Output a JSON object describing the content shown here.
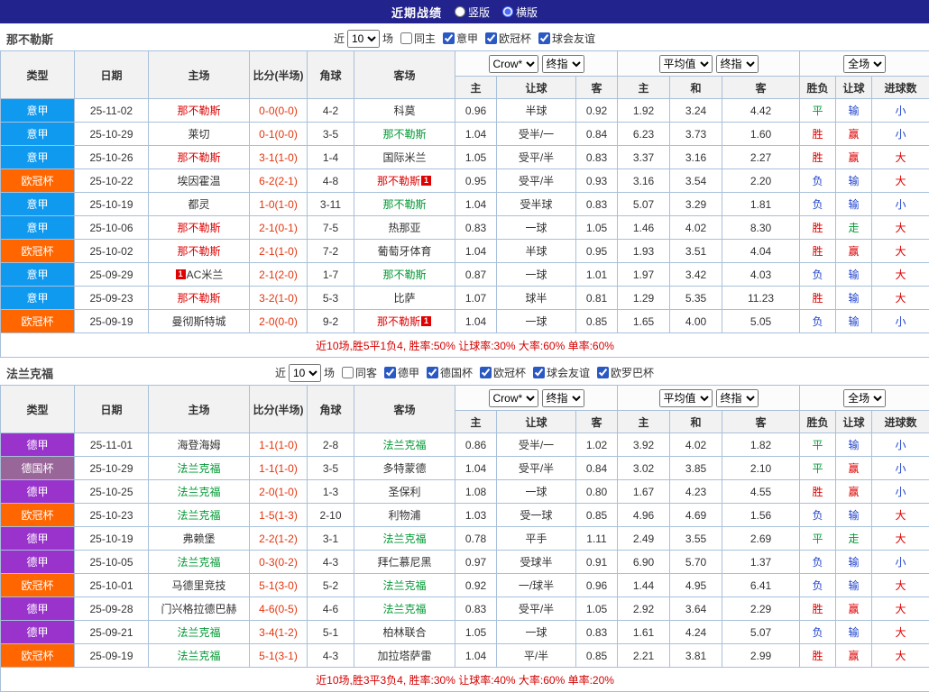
{
  "topbar": {
    "title": "近期战绩",
    "radio_vertical": "竖版",
    "radio_horizontal": "横版",
    "selected_layout": "横版"
  },
  "colors": {
    "topbar_bg": "#23238e",
    "border": "#a8c0da",
    "score": "#e3350d",
    "type": {
      "意甲": "#0f9af0",
      "欧冠杯": "#ff6600",
      "德甲": "#9933cc",
      "德国杯": "#996699"
    },
    "text": {
      "red": "#dd0000",
      "green": "#009933",
      "blue": "#2244cc",
      "black": "#333333"
    }
  },
  "filter_labels": {
    "near": "近",
    "games": "场"
  },
  "table": {
    "col_headers": [
      "类型",
      "日期",
      "主场",
      "比分(半场)",
      "角球",
      "客场"
    ],
    "sub_headers": [
      "主",
      "让球",
      "客",
      "主",
      "和",
      "客",
      "胜负",
      "让球",
      "进球数"
    ],
    "selects": {
      "odds": "Crow*",
      "odds_stage": "终指",
      "euro": "平均值",
      "euro_stage": "终指",
      "scope": "全场"
    }
  },
  "sections": [
    {
      "team": "那不勒斯",
      "filters": {
        "count": "10",
        "checkboxes": [
          {
            "label": "同主",
            "checked": false
          },
          {
            "label": "意甲",
            "checked": true
          },
          {
            "label": "欧冠杯",
            "checked": true
          },
          {
            "label": "球会友谊",
            "checked": true
          }
        ]
      },
      "rows": [
        {
          "type": "意甲",
          "date": "25-11-02",
          "home": {
            "name": "那不勒斯",
            "color": "red"
          },
          "score": "0-0(0-0)",
          "corner": "4-2",
          "away": {
            "name": "科莫",
            "color": "black"
          },
          "odds": [
            "0.96",
            "半球",
            "0.92"
          ],
          "euro": [
            "1.92",
            "3.24",
            "4.42"
          ],
          "res": [
            {
              "t": "平",
              "c": "green"
            },
            {
              "t": "输",
              "c": "blue"
            },
            {
              "t": "小",
              "c": "blue"
            }
          ]
        },
        {
          "type": "意甲",
          "date": "25-10-29",
          "home": {
            "name": "莱切",
            "color": "black"
          },
          "score": "0-1(0-0)",
          "corner": "3-5",
          "away": {
            "name": "那不勒斯",
            "color": "green"
          },
          "odds": [
            "1.04",
            "受半/一",
            "0.84"
          ],
          "euro": [
            "6.23",
            "3.73",
            "1.60"
          ],
          "res": [
            {
              "t": "胜",
              "c": "red"
            },
            {
              "t": "赢",
              "c": "red"
            },
            {
              "t": "小",
              "c": "blue"
            }
          ]
        },
        {
          "type": "意甲",
          "date": "25-10-26",
          "home": {
            "name": "那不勒斯",
            "color": "red"
          },
          "score": "3-1(1-0)",
          "corner": "1-4",
          "away": {
            "name": "国际米兰",
            "color": "black"
          },
          "odds": [
            "1.05",
            "受平/半",
            "0.83"
          ],
          "euro": [
            "3.37",
            "3.16",
            "2.27"
          ],
          "res": [
            {
              "t": "胜",
              "c": "red"
            },
            {
              "t": "赢",
              "c": "red"
            },
            {
              "t": "大",
              "c": "red"
            }
          ]
        },
        {
          "type": "欧冠杯",
          "date": "25-10-22",
          "home": {
            "name": "埃因霍温",
            "color": "black"
          },
          "score": "6-2(2-1)",
          "corner": "4-8",
          "away": {
            "name": "那不勒斯",
            "color": "red",
            "badge": "1",
            "badge_pos": "after"
          },
          "odds": [
            "0.95",
            "受平/半",
            "0.93"
          ],
          "euro": [
            "3.16",
            "3.54",
            "2.20"
          ],
          "res": [
            {
              "t": "负",
              "c": "blue"
            },
            {
              "t": "输",
              "c": "blue"
            },
            {
              "t": "大",
              "c": "red"
            }
          ]
        },
        {
          "type": "意甲",
          "date": "25-10-19",
          "home": {
            "name": "都灵",
            "color": "black"
          },
          "score": "1-0(1-0)",
          "corner": "3-11",
          "away": {
            "name": "那不勒斯",
            "color": "green"
          },
          "odds": [
            "1.04",
            "受半球",
            "0.83"
          ],
          "euro": [
            "5.07",
            "3.29",
            "1.81"
          ],
          "res": [
            {
              "t": "负",
              "c": "blue"
            },
            {
              "t": "输",
              "c": "blue"
            },
            {
              "t": "小",
              "c": "blue"
            }
          ]
        },
        {
          "type": "意甲",
          "date": "25-10-06",
          "home": {
            "name": "那不勒斯",
            "color": "red"
          },
          "score": "2-1(0-1)",
          "corner": "7-5",
          "away": {
            "name": "热那亚",
            "color": "black"
          },
          "odds": [
            "0.83",
            "一球",
            "1.05"
          ],
          "euro": [
            "1.46",
            "4.02",
            "8.30"
          ],
          "res": [
            {
              "t": "胜",
              "c": "red"
            },
            {
              "t": "走",
              "c": "green"
            },
            {
              "t": "大",
              "c": "red"
            }
          ]
        },
        {
          "type": "欧冠杯",
          "date": "25-10-02",
          "home": {
            "name": "那不勒斯",
            "color": "red"
          },
          "score": "2-1(1-0)",
          "corner": "7-2",
          "away": {
            "name": "葡萄牙体育",
            "color": "black"
          },
          "odds": [
            "1.04",
            "半球",
            "0.95"
          ],
          "euro": [
            "1.93",
            "3.51",
            "4.04"
          ],
          "res": [
            {
              "t": "胜",
              "c": "red"
            },
            {
              "t": "赢",
              "c": "red"
            },
            {
              "t": "大",
              "c": "red"
            }
          ]
        },
        {
          "type": "意甲",
          "date": "25-09-29",
          "home": {
            "name": "AC米兰",
            "color": "black",
            "badge": "1",
            "badge_pos": "before"
          },
          "score": "2-1(2-0)",
          "corner": "1-7",
          "away": {
            "name": "那不勒斯",
            "color": "green"
          },
          "odds": [
            "0.87",
            "一球",
            "1.01"
          ],
          "euro": [
            "1.97",
            "3.42",
            "4.03"
          ],
          "res": [
            {
              "t": "负",
              "c": "blue"
            },
            {
              "t": "输",
              "c": "blue"
            },
            {
              "t": "大",
              "c": "red"
            }
          ]
        },
        {
          "type": "意甲",
          "date": "25-09-23",
          "home": {
            "name": "那不勒斯",
            "color": "red"
          },
          "score": "3-2(1-0)",
          "corner": "5-3",
          "away": {
            "name": "比萨",
            "color": "black"
          },
          "odds": [
            "1.07",
            "球半",
            "0.81"
          ],
          "euro": [
            "1.29",
            "5.35",
            "11.23"
          ],
          "res": [
            {
              "t": "胜",
              "c": "red"
            },
            {
              "t": "输",
              "c": "blue"
            },
            {
              "t": "大",
              "c": "red"
            }
          ]
        },
        {
          "type": "欧冠杯",
          "date": "25-09-19",
          "home": {
            "name": "曼彻斯特城",
            "color": "black"
          },
          "score": "2-0(0-0)",
          "corner": "9-2",
          "away": {
            "name": "那不勒斯",
            "color": "red",
            "badge": "1",
            "badge_pos": "after"
          },
          "odds": [
            "1.04",
            "一球",
            "0.85"
          ],
          "euro": [
            "1.65",
            "4.00",
            "5.05"
          ],
          "res": [
            {
              "t": "负",
              "c": "blue"
            },
            {
              "t": "输",
              "c": "blue"
            },
            {
              "t": "小",
              "c": "blue"
            }
          ]
        }
      ],
      "summary": "近10场,胜5平1负4, 胜率:50% 让球率:30% 大率:60% 单率:60%"
    },
    {
      "team": "法兰克福",
      "filters": {
        "count": "10",
        "checkboxes": [
          {
            "label": "同客",
            "checked": false
          },
          {
            "label": "德甲",
            "checked": true
          },
          {
            "label": "德国杯",
            "checked": true
          },
          {
            "label": "欧冠杯",
            "checked": true
          },
          {
            "label": "球会友谊",
            "checked": true
          },
          {
            "label": "欧罗巴杯",
            "checked": true
          }
        ]
      },
      "rows": [
        {
          "type": "德甲",
          "date": "25-11-01",
          "home": {
            "name": "海登海姆",
            "color": "black"
          },
          "score": "1-1(1-0)",
          "corner": "2-8",
          "away": {
            "name": "法兰克福",
            "color": "green"
          },
          "odds": [
            "0.86",
            "受半/一",
            "1.02"
          ],
          "euro": [
            "3.92",
            "4.02",
            "1.82"
          ],
          "res": [
            {
              "t": "平",
              "c": "green"
            },
            {
              "t": "输",
              "c": "blue"
            },
            {
              "t": "小",
              "c": "blue"
            }
          ]
        },
        {
          "type": "德国杯",
          "date": "25-10-29",
          "home": {
            "name": "法兰克福",
            "color": "green"
          },
          "score": "1-1(1-0)",
          "corner": "3-5",
          "away": {
            "name": "多特蒙德",
            "color": "black"
          },
          "odds": [
            "1.04",
            "受平/半",
            "0.84"
          ],
          "euro": [
            "3.02",
            "3.85",
            "2.10"
          ],
          "res": [
            {
              "t": "平",
              "c": "green"
            },
            {
              "t": "赢",
              "c": "red"
            },
            {
              "t": "小",
              "c": "blue"
            }
          ]
        },
        {
          "type": "德甲",
          "date": "25-10-25",
          "home": {
            "name": "法兰克福",
            "color": "green"
          },
          "score": "2-0(1-0)",
          "corner": "1-3",
          "away": {
            "name": "圣保利",
            "color": "black"
          },
          "odds": [
            "1.08",
            "一球",
            "0.80"
          ],
          "euro": [
            "1.67",
            "4.23",
            "4.55"
          ],
          "res": [
            {
              "t": "胜",
              "c": "red"
            },
            {
              "t": "赢",
              "c": "red"
            },
            {
              "t": "小",
              "c": "blue"
            }
          ]
        },
        {
          "type": "欧冠杯",
          "date": "25-10-23",
          "home": {
            "name": "法兰克福",
            "color": "green"
          },
          "score": "1-5(1-3)",
          "corner": "2-10",
          "away": {
            "name": "利物浦",
            "color": "black"
          },
          "odds": [
            "1.03",
            "受一球",
            "0.85"
          ],
          "euro": [
            "4.96",
            "4.69",
            "1.56"
          ],
          "res": [
            {
              "t": "负",
              "c": "blue"
            },
            {
              "t": "输",
              "c": "blue"
            },
            {
              "t": "大",
              "c": "red"
            }
          ]
        },
        {
          "type": "德甲",
          "date": "25-10-19",
          "home": {
            "name": "弗赖堡",
            "color": "black"
          },
          "score": "2-2(1-2)",
          "corner": "3-1",
          "away": {
            "name": "法兰克福",
            "color": "green"
          },
          "odds": [
            "0.78",
            "平手",
            "1.11"
          ],
          "euro": [
            "2.49",
            "3.55",
            "2.69"
          ],
          "res": [
            {
              "t": "平",
              "c": "green"
            },
            {
              "t": "走",
              "c": "green"
            },
            {
              "t": "大",
              "c": "red"
            }
          ]
        },
        {
          "type": "德甲",
          "date": "25-10-05",
          "home": {
            "name": "法兰克福",
            "color": "green"
          },
          "score": "0-3(0-2)",
          "corner": "4-3",
          "away": {
            "name": "拜仁慕尼黑",
            "color": "black"
          },
          "odds": [
            "0.97",
            "受球半",
            "0.91"
          ],
          "euro": [
            "6.90",
            "5.70",
            "1.37"
          ],
          "res": [
            {
              "t": "负",
              "c": "blue"
            },
            {
              "t": "输",
              "c": "blue"
            },
            {
              "t": "小",
              "c": "blue"
            }
          ]
        },
        {
          "type": "欧冠杯",
          "date": "25-10-01",
          "home": {
            "name": "马德里竞技",
            "color": "black"
          },
          "score": "5-1(3-0)",
          "corner": "5-2",
          "away": {
            "name": "法兰克福",
            "color": "green"
          },
          "odds": [
            "0.92",
            "一/球半",
            "0.96"
          ],
          "euro": [
            "1.44",
            "4.95",
            "6.41"
          ],
          "res": [
            {
              "t": "负",
              "c": "blue"
            },
            {
              "t": "输",
              "c": "blue"
            },
            {
              "t": "大",
              "c": "red"
            }
          ]
        },
        {
          "type": "德甲",
          "date": "25-09-28",
          "home": {
            "name": "门兴格拉德巴赫",
            "color": "black"
          },
          "score": "4-6(0-5)",
          "corner": "4-6",
          "away": {
            "name": "法兰克福",
            "color": "green"
          },
          "odds": [
            "0.83",
            "受平/半",
            "1.05"
          ],
          "euro": [
            "2.92",
            "3.64",
            "2.29"
          ],
          "res": [
            {
              "t": "胜",
              "c": "red"
            },
            {
              "t": "赢",
              "c": "red"
            },
            {
              "t": "大",
              "c": "red"
            }
          ]
        },
        {
          "type": "德甲",
          "date": "25-09-21",
          "home": {
            "name": "法兰克福",
            "color": "green"
          },
          "score": "3-4(1-2)",
          "corner": "5-1",
          "away": {
            "name": "柏林联合",
            "color": "black"
          },
          "odds": [
            "1.05",
            "一球",
            "0.83"
          ],
          "euro": [
            "1.61",
            "4.24",
            "5.07"
          ],
          "res": [
            {
              "t": "负",
              "c": "blue"
            },
            {
              "t": "输",
              "c": "blue"
            },
            {
              "t": "大",
              "c": "red"
            }
          ]
        },
        {
          "type": "欧冠杯",
          "date": "25-09-19",
          "home": {
            "name": "法兰克福",
            "color": "green"
          },
          "score": "5-1(3-1)",
          "corner": "4-3",
          "away": {
            "name": "加拉塔萨雷",
            "color": "black"
          },
          "odds": [
            "1.04",
            "平/半",
            "0.85"
          ],
          "euro": [
            "2.21",
            "3.81",
            "2.99"
          ],
          "res": [
            {
              "t": "胜",
              "c": "red"
            },
            {
              "t": "赢",
              "c": "red"
            },
            {
              "t": "大",
              "c": "red"
            }
          ]
        }
      ],
      "summary": "近10场,胜3平3负4, 胜率:30% 让球率:40% 大率:60% 单率:20%"
    }
  ]
}
